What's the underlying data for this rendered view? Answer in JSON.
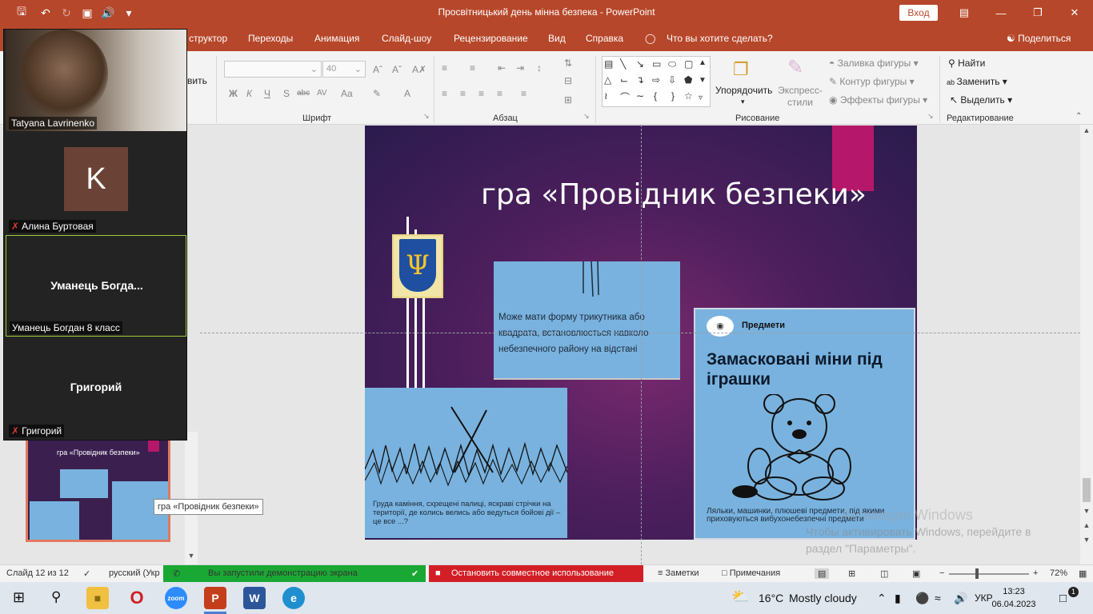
{
  "titlebar": {
    "title": "Просвітницький день мінна безпека  -  PowerPoint",
    "signin": "Вход",
    "icons": [
      "save-icon",
      "undo-icon",
      "redo-icon",
      "present-icon",
      "audio-icon",
      "customize-icon"
    ],
    "accent": "#b7472a"
  },
  "tabs": {
    "items": [
      "структор",
      "Переходы",
      "Анимация",
      "Слайд-шоу",
      "Рецензирование",
      "Вид",
      "Справка"
    ],
    "tell_me": "Что вы хотите сделать?",
    "share": "Поделиться"
  },
  "ribbon": {
    "font_size": "40",
    "clipboard_partial": "вить",
    "format_buttons": [
      "Ж",
      "К",
      "Ч",
      "S",
      "abc",
      "AV",
      "Aa"
    ],
    "group_font": "Шрифт",
    "group_paragraph": "Абзац",
    "group_drawing": "Рисование",
    "group_editing": "Редактирование",
    "arrange": "Упорядочить",
    "quick_styles": "Экспресс-\nстили",
    "shape_fill": "Заливка фигуры",
    "shape_outline": "Контур фигуры",
    "shape_effects": "Эффекты фигуры",
    "find": "Найти",
    "replace": "Заменить",
    "select": "Выделить"
  },
  "slide": {
    "title": "гра «Провідник безпеки»",
    "box1_text": "Може мати форму трикутника або квадрата, встановлюється навколо небезпечного району на відстані",
    "box2_text": "Груда каміння, схрещені палиці, яскраві стрічки на території, де колись велись або ведуться бойові дії – це все ...?",
    "box3_category": "Предмети",
    "box3_heading": "Замасковані міни під іграшки",
    "box3_footer": "Ляльки, машинки, плюшеві предмети, під якими приховуються вибухонебезпечні предмети",
    "bg_color": "#4d1f5d",
    "accent_pink": "#b5186a",
    "box_color": "#79b2de"
  },
  "thumbnail": {
    "title": "гра «Провідник безпеки»",
    "tooltip": "гра «Провідник безпеки»",
    "selected_border": "#e1795f"
  },
  "watermark": {
    "line1": "Активация Windows",
    "line2": "Чтобы активировать Windows, перейдите в",
    "line3": "раздел \"Параметры\"."
  },
  "zoom": {
    "participants": [
      {
        "name": "Tatyana Lavrinenko",
        "muted": false,
        "video": true
      },
      {
        "name": "Алина Буртовая",
        "muted": true,
        "avatar": "K"
      },
      {
        "name": "Уманець Богдан 8 класс",
        "center": "Уманець  Богда...",
        "muted": false,
        "active": true
      },
      {
        "name": "Григорий",
        "center": "Григорий",
        "muted": true
      }
    ],
    "share_notice": "Вы запустили демонстрацию экрана",
    "stop_share": "Остановить совместное использование"
  },
  "statusbar": {
    "slide_counter": "Слайд 12 из 12",
    "language": "русский (Укр",
    "notes": "Заметки",
    "comments": "Примечания",
    "zoom": "72%"
  },
  "taskbar": {
    "weather_temp": "16°C",
    "weather_text": "Mostly cloudy",
    "lang": "УКР",
    "time": "13:23",
    "date": "06.04.2023",
    "notification_count": "1",
    "zoom_app_label": "zoom"
  }
}
